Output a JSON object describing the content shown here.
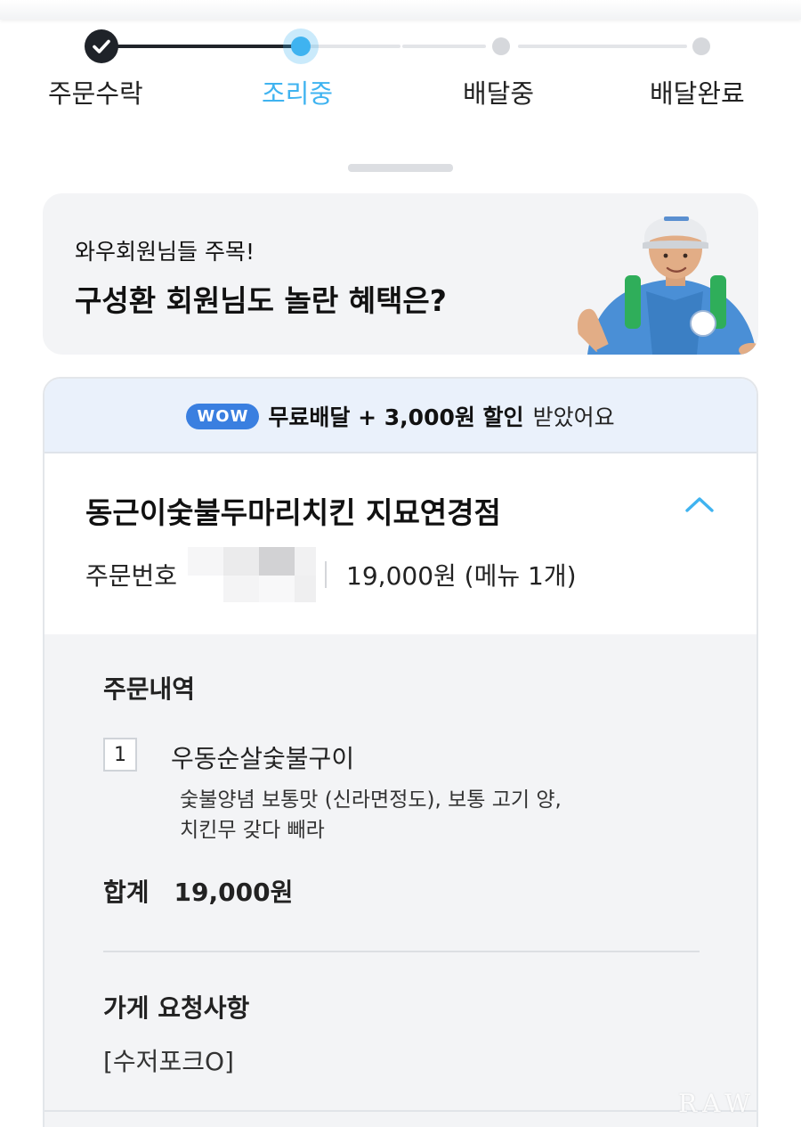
{
  "tracker": {
    "steps": [
      {
        "label": "주문수락",
        "state": "done"
      },
      {
        "label": "조리중",
        "state": "current"
      },
      {
        "label": "배달중",
        "state": "pending"
      },
      {
        "label": "배달완료",
        "state": "pending"
      }
    ],
    "colors": {
      "done": "#1f2329",
      "current": "#3fb3f0",
      "pending": "#d4d6da"
    }
  },
  "banner": {
    "subtitle": "와우회원님들 주목!",
    "title": "구성환 회원님도 놀란 혜택은?"
  },
  "order": {
    "wow_badge": "WOW",
    "wow_benefit": "무료배달 + 3,000원 할인",
    "wow_suffix": "받았어요",
    "store_name": "동근이숯불두마리치킨 지묘연경점",
    "order_number_label": "주문번호",
    "order_summary": "19,000원 (메뉴 1개)",
    "details_title": "주문내역",
    "items": [
      {
        "qty": "1",
        "name": "우동순살숯불구이",
        "options": [
          "숯불양념 보통맛 (신라면정도), 보통 고기 양,",
          "치킨무 갖다 빼라"
        ]
      }
    ],
    "total_label": "합계",
    "total_value": "19,000원",
    "request_title": "가게 요청사항",
    "request_value": "[수저포크O]"
  },
  "watermark": "RAW"
}
